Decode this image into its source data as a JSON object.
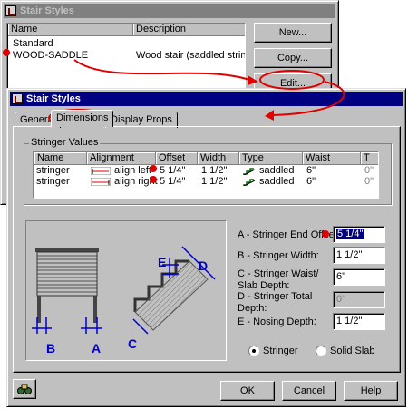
{
  "back_dialog": {
    "title": "Stair Styles",
    "columns": [
      "Name",
      "Description"
    ],
    "rows": [
      {
        "name": "Standard",
        "description": ""
      },
      {
        "name": "WOOD-SADDLE",
        "description": "Wood stair (saddled stringers)"
      }
    ],
    "buttons": {
      "new": "New...",
      "copy": "Copy...",
      "edit": "Edit..."
    }
  },
  "front_dialog": {
    "title": "Stair Styles",
    "tabs": [
      "General",
      "Dimensions",
      "Display Props"
    ],
    "active_tab": "Dimensions",
    "group_label": "Stringer Values",
    "columns": [
      "Name",
      "Alignment",
      "Offset",
      "Width",
      "Type",
      "Waist",
      "T"
    ],
    "rows": [
      {
        "name": "stringer",
        "alignment": "align left",
        "offset": "5 1/4\"",
        "width": "1 1/2\"",
        "type": "saddled",
        "waist": "6\"",
        "t": "0\""
      },
      {
        "name": "stringer",
        "alignment": "align right",
        "offset": "5 1/4\"",
        "width": "1 1/2\"",
        "type": "saddled",
        "waist": "6\"",
        "t": "0\""
      }
    ],
    "fields": [
      {
        "label": "A - Stringer End Offset:",
        "value": "5 1/4\"",
        "enabled": true,
        "selected": true
      },
      {
        "label": "B - Stringer Width:",
        "value": "1 1/2\"",
        "enabled": true,
        "selected": false
      },
      {
        "label": "C - Stringer Waist/ Slab Depth:",
        "value": "6\"",
        "enabled": true,
        "selected": false
      },
      {
        "label": "D - Stringer Total Depth:",
        "value": "0\"",
        "enabled": false,
        "selected": false
      },
      {
        "label": "E - Nosing Depth:",
        "value": "1 1/2\"",
        "enabled": true,
        "selected": false
      }
    ],
    "radios": [
      {
        "label": "Stringer",
        "checked": true
      },
      {
        "label": "Solid Slab",
        "checked": false
      }
    ],
    "buttons": {
      "ok": "OK",
      "cancel": "Cancel",
      "help": "Help"
    },
    "diagram_labels": {
      "a": "A",
      "b": "B",
      "c": "C",
      "d": "D",
      "e": "E"
    }
  },
  "colors": {
    "annotation_red": "#e00000",
    "dimension_blue": "#0000c8",
    "active_title": "#000080",
    "inactive_title": "#808080",
    "dialog_gray": "#c0c0c0"
  }
}
